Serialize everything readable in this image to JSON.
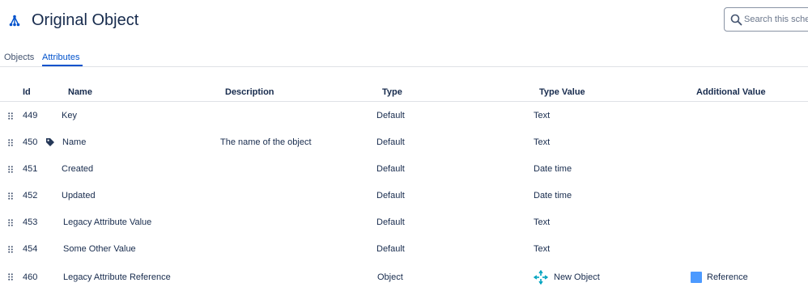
{
  "header": {
    "title": "Original Object",
    "search": {
      "placeholder": "Search this schema",
      "value": ""
    }
  },
  "tabs": [
    {
      "label": "Objects",
      "active": false
    },
    {
      "label": "Attributes",
      "active": true
    }
  ],
  "table": {
    "columns": [
      "Id",
      "Name",
      "Description",
      "Type",
      "Type Value",
      "Additional Value"
    ],
    "rows": [
      {
        "id": "449",
        "name": "Key",
        "description": "",
        "type": "Default",
        "type_value": "Text",
        "additional_value": "",
        "label_attribute": false
      },
      {
        "id": "450",
        "name": "Name",
        "description": "The name of the object",
        "type": "Default",
        "type_value": "Text",
        "additional_value": "",
        "label_attribute": true
      },
      {
        "id": "451",
        "name": "Created",
        "description": "",
        "type": "Default",
        "type_value": "Date time",
        "additional_value": ""
      },
      {
        "id": "452",
        "name": "Updated",
        "description": "",
        "type": "Default",
        "type_value": "Date time",
        "additional_value": ""
      },
      {
        "id": "453",
        "name": "Legacy Attribute Value",
        "description": "",
        "type": "Default",
        "type_value": "Text",
        "additional_value": ""
      },
      {
        "id": "454",
        "name": "Some Other Value",
        "description": "",
        "type": "Default",
        "type_value": "Text",
        "additional_value": ""
      },
      {
        "id": "460",
        "name": "Legacy Attribute Reference",
        "description": "",
        "type": "Object",
        "type_value": "New Object",
        "type_value_icon": "object-type-icon",
        "additional_value": "Reference",
        "additional_value_color": "#4c9aff"
      }
    ]
  },
  "colors": {
    "accent": "#0052cc",
    "text": "#172b4d",
    "object_icon": "#00a3bf",
    "reference": "#4c9aff"
  }
}
